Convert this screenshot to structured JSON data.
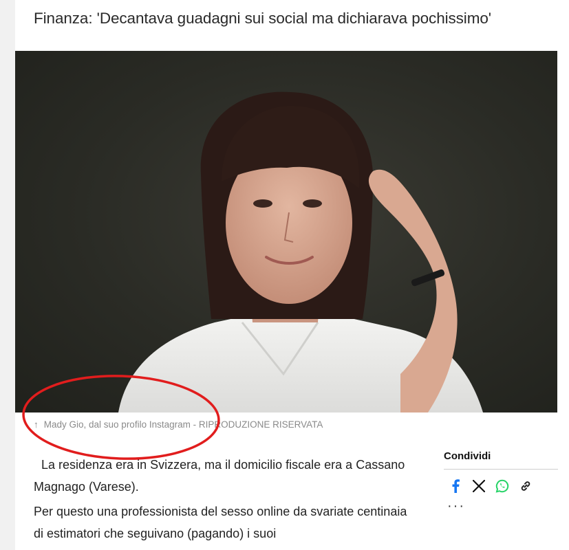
{
  "article": {
    "headline": "Finanza: 'Decantava guadagni sui social ma dichiarava pochissimo'",
    "caption_arrow": "↑",
    "caption": "Mady Gio, dal suo profilo Instagram - RIPRODUZIONE RISERVATA",
    "paragraphs": [
      "La residenza era in Svizzera, ma il domicilio fiscale era a Cassano Magnago (Varese).",
      "Per questo una professionista del sesso online da svariate centinaia di estimatori che seguivano (pagando) i suoi"
    ]
  },
  "share": {
    "title": "Condividi",
    "more": "···",
    "icons": [
      "facebook-icon",
      "x-icon",
      "whatsapp-icon",
      "link-icon"
    ]
  },
  "colors": {
    "annotation": "#e11d1d",
    "facebook": "#1877f2",
    "whatsapp": "#25d366",
    "caption": "#8a8a8a"
  }
}
